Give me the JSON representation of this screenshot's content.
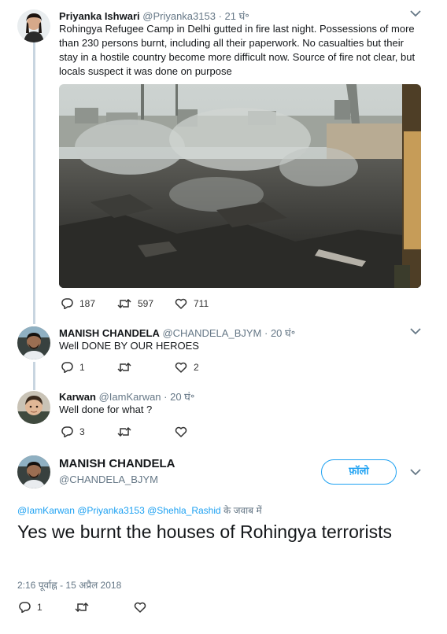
{
  "tweet1": {
    "name": "Priyanka Ishwari",
    "handle": "@Priyanka3153",
    "time": "· 21 घं॰",
    "lines": [
      "Rohingya Refugee Camp in Delhi gutted in fire last night. Possessions of  more",
      "than 230 persons burnt, including all their paperwork. No casualties but their",
      "stay in a hostile country become more difficult now. Source of fire not clear, but",
      "locals suspect it was done on purpose"
    ],
    "replies": "187",
    "retweets": "597",
    "likes": "711"
  },
  "reply1": {
    "name": "MANISH CHANDELA",
    "handle": "@CHANDELA_BJYM",
    "time": "· 20 घं॰",
    "text": "Well DONE BY OUR HEROES",
    "replies": "1",
    "retweets": "",
    "likes": "2"
  },
  "reply2": {
    "name": "Karwan",
    "handle": "@IamKarwan",
    "time": "· 20 घं॰",
    "text": "Well done for what ?",
    "replies": "3",
    "retweets": "",
    "likes": ""
  },
  "main": {
    "name": "MANISH CHANDELA",
    "handle": "@CHANDELA_BJYM",
    "follow_label": "फ़ॉलो",
    "reply_to_handles": "@IamKarwan @Priyanka3153 @Shehla_Rashid",
    "reply_to_suffix": " के जवाब में",
    "text": "Yes we burnt the houses of Rohingya terrorists",
    "timestamp": "2:16 पूर्वाह्न - 15 अप्रैल 2018",
    "replies": "1",
    "retweets": "",
    "likes": ""
  },
  "colors": {
    "accent": "#1da1f2",
    "thread_line": "#c8d5e0",
    "muted_text": "#657786"
  },
  "icons": [
    "reply-icon",
    "retweet-icon",
    "like-icon",
    "chevron-down-icon"
  ]
}
